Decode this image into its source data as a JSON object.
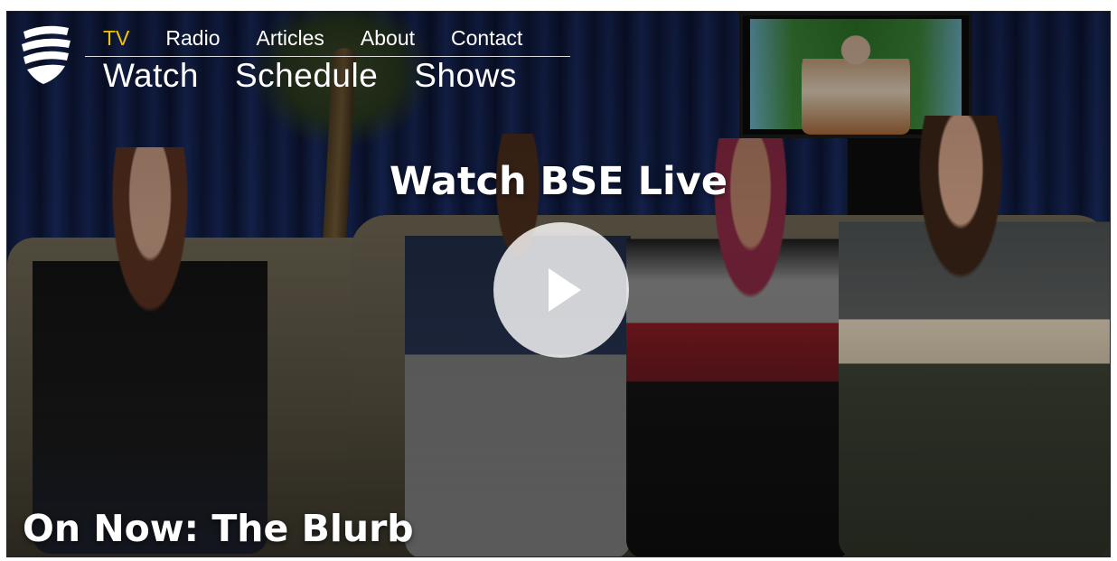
{
  "nav": {
    "top": [
      {
        "label": "TV",
        "active": true
      },
      {
        "label": "Radio",
        "active": false
      },
      {
        "label": "Articles",
        "active": false
      },
      {
        "label": "About",
        "active": false
      },
      {
        "label": "Contact",
        "active": false
      }
    ],
    "sub": [
      {
        "label": "Watch"
      },
      {
        "label": "Schedule"
      },
      {
        "label": "Shows"
      }
    ]
  },
  "hero": {
    "title": "Watch BSE Live",
    "on_now": "On Now: The Blurb"
  },
  "icons": {
    "logo": "bse-logo-icon",
    "play": "play-icon"
  },
  "colors": {
    "active_nav": "#f2c500",
    "text": "#ffffff"
  }
}
